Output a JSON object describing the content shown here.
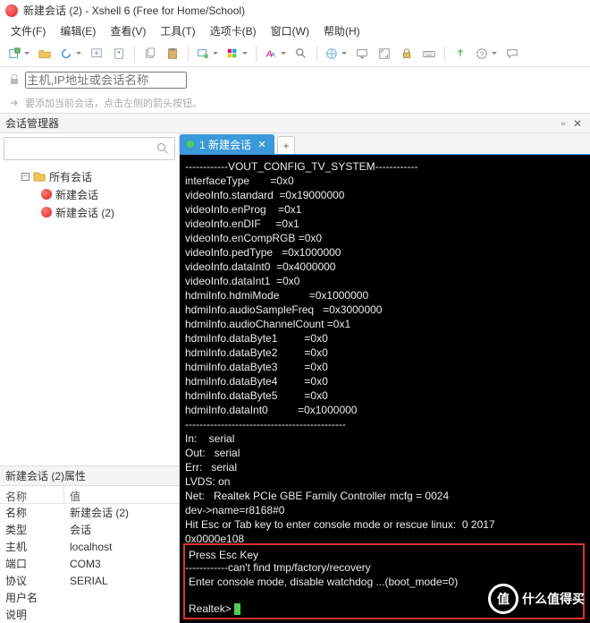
{
  "window": {
    "title": "新建会话 (2) - Xshell 6 (Free for Home/School)"
  },
  "menu": [
    "文件(F)",
    "编辑(E)",
    "查看(V)",
    "工具(T)",
    "选项卡(B)",
    "窗口(W)",
    "帮助(H)"
  ],
  "address": {
    "placeholder": "主机,IP地址或会话名称"
  },
  "hint": {
    "text": "要添加当前会话，点击左侧的箭头按钮。"
  },
  "sessionMgr": {
    "title": "会话管理器",
    "root": "所有会话",
    "items": [
      "新建会话",
      "新建会话 (2)"
    ]
  },
  "props": {
    "header": "新建会话 (2)属性",
    "colName": "名称",
    "colValue": "值",
    "rows": [
      {
        "k": "名称",
        "v": "新建会话 (2)"
      },
      {
        "k": "类型",
        "v": "会话"
      },
      {
        "k": "主机",
        "v": "localhost"
      },
      {
        "k": "端口",
        "v": "COM3"
      },
      {
        "k": "协议",
        "v": "SERIAL"
      },
      {
        "k": "用户名",
        "v": ""
      },
      {
        "k": "说明",
        "v": ""
      }
    ]
  },
  "tabs": {
    "active": "1 新建会话",
    "addLabel": "+"
  },
  "terminal": {
    "main": "------------VOUT_CONFIG_TV_SYSTEM------------\ninterfaceType       =0x0\nvideoInfo.standard  =0x19000000\nvideoInfo.enProg    =0x1\nvideoInfo.enDIF     =0x1\nvideoInfo.enCompRGB =0x0\nvideoInfo.pedType   =0x1000000\nvideoInfo.dataInt0  =0x4000000\nvideoInfo.dataInt1  =0x0\nhdmiInfo.hdmiMode          =0x1000000\nhdmiInfo.audioSampleFreq   =0x3000000\nhdmiInfo.audioChannelCount =0x1\nhdmiInfo.dataByte1         =0x0\nhdmiInfo.dataByte2         =0x0\nhdmiInfo.dataByte3         =0x0\nhdmiInfo.dataByte4         =0x0\nhdmiInfo.dataByte5         =0x0\nhdmiInfo.dataInt0          =0x1000000\n---------------------------------------------\nIn:    serial\nOut:   serial\nErr:   serial\nLVDS: on\nNet:   Realtek PCIe GBE Family Controller mcfg = 0024\ndev->name=r8168#0\nHit Esc or Tab key to enter console mode or rescue linux:  0 2017\n0x0000e108\n\n------------can't find tmp/factory/recovery",
    "box": "Press Esc Key\n\nEnter console mode, disable watchdog ...(boot_mode=0)\n\nRealtek> "
  },
  "watermark": {
    "badge": "值",
    "text": "什么值得买"
  }
}
